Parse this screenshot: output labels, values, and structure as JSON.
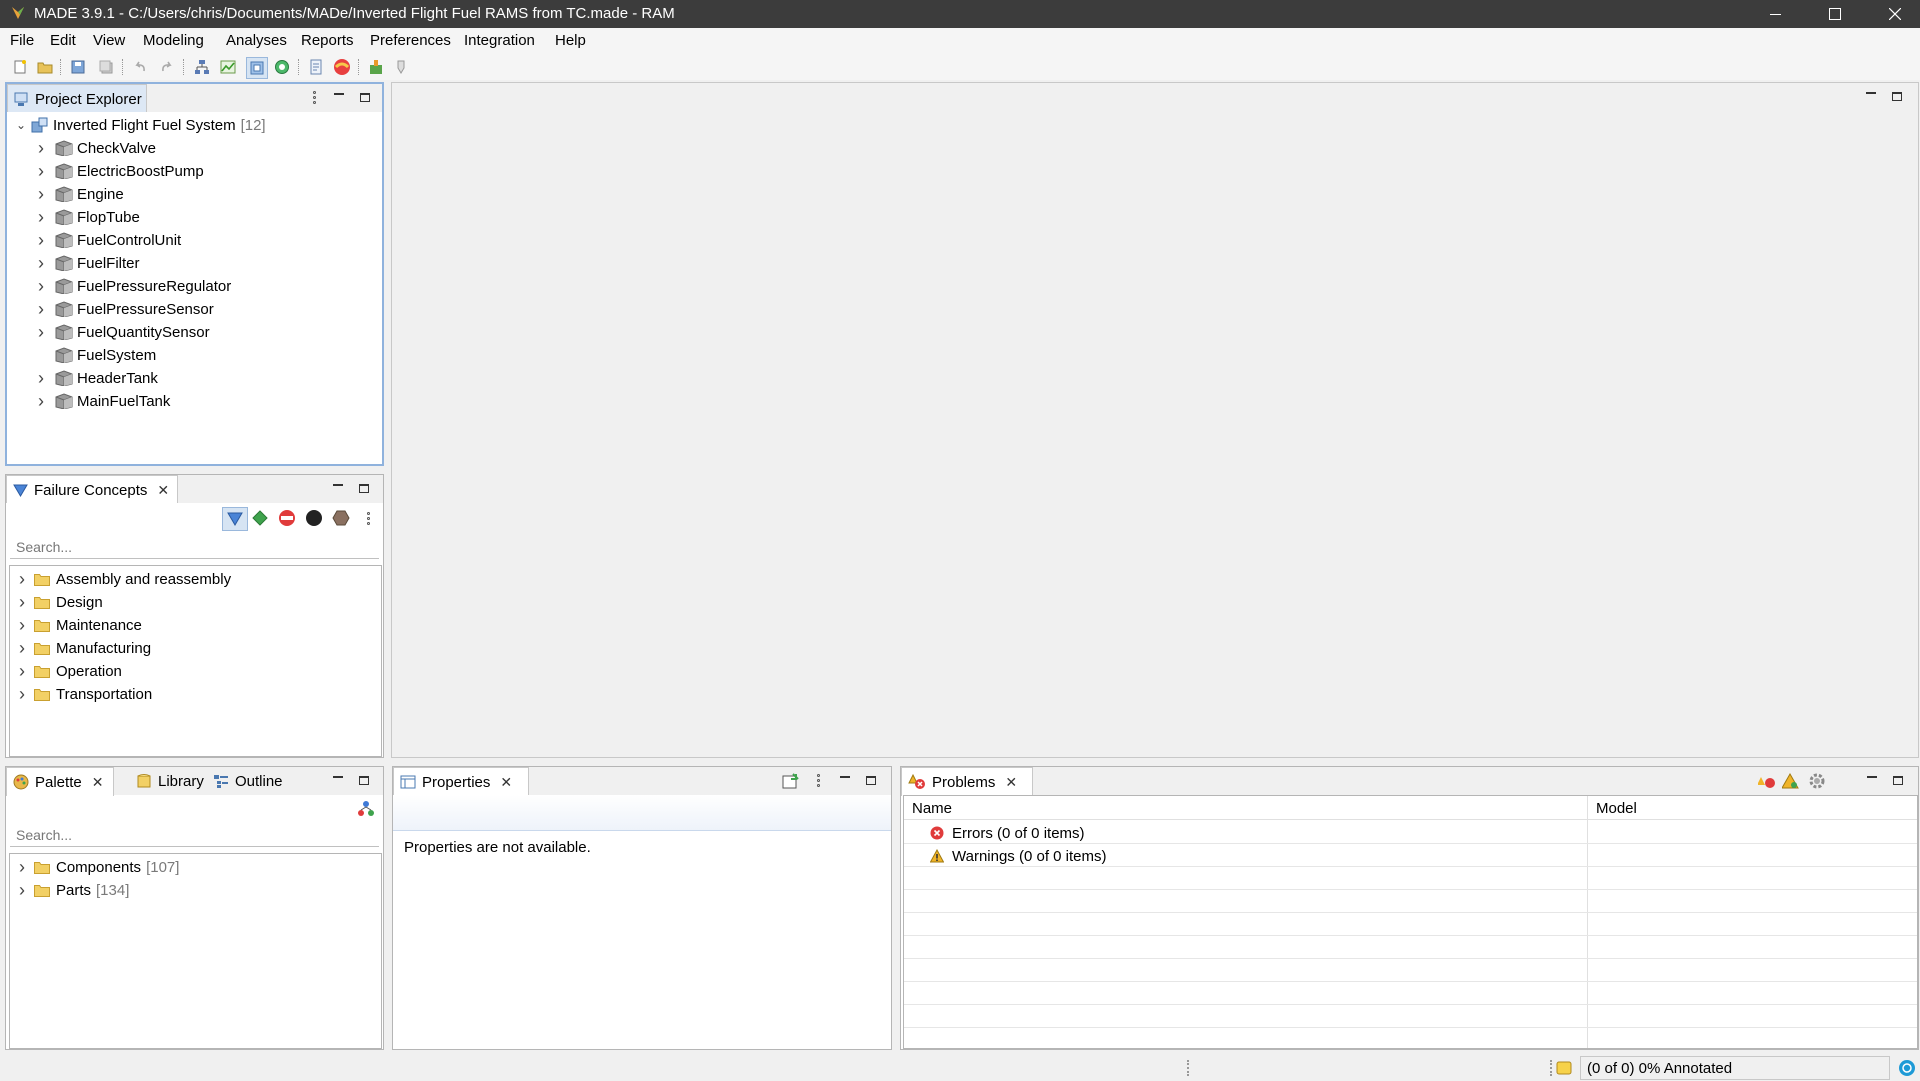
{
  "window": {
    "title": "MADE 3.9.1 - C:/Users/chris/Documents/MADe/Inverted Flight Fuel RAMS from TC.made - RAM"
  },
  "menu": [
    "File",
    "Edit",
    "View",
    "Modeling",
    "Analyses",
    "Reports",
    "Preferences",
    "Integration",
    "Help"
  ],
  "project_explorer": {
    "tab_label": "Project Explorer",
    "root": {
      "label": "Inverted Flight Fuel System",
      "count": "[12]"
    },
    "items": [
      {
        "label": "CheckValve",
        "expandable": true
      },
      {
        "label": "ElectricBoostPump",
        "expandable": true
      },
      {
        "label": "Engine",
        "expandable": true
      },
      {
        "label": "FlopTube",
        "expandable": true
      },
      {
        "label": "FuelControlUnit",
        "expandable": true
      },
      {
        "label": "FuelFilter",
        "expandable": true
      },
      {
        "label": "FuelPressureRegulator",
        "expandable": true
      },
      {
        "label": "FuelPressureSensor",
        "expandable": true
      },
      {
        "label": "FuelQuantitySensor",
        "expandable": true
      },
      {
        "label": "FuelSystem",
        "expandable": false
      },
      {
        "label": "HeaderTank",
        "expandable": true
      },
      {
        "label": "MainFuelTank",
        "expandable": true
      }
    ]
  },
  "failure_concepts": {
    "tab_label": "Failure Concepts",
    "search_placeholder": "Search...",
    "folders": [
      "Assembly and reassembly",
      "Design",
      "Maintenance",
      "Manufacturing",
      "Operation",
      "Transportation"
    ]
  },
  "palette": {
    "tabs": [
      "Palette",
      "Library",
      "Outline"
    ],
    "search_placeholder": "Search...",
    "folders": [
      {
        "label": "Components",
        "count": "[107]"
      },
      {
        "label": "Parts",
        "count": "[134]"
      }
    ]
  },
  "properties": {
    "tab_label": "Properties",
    "message": "Properties are not available."
  },
  "problems": {
    "tab_label": "Problems",
    "columns": [
      "Name",
      "Model"
    ],
    "rows": [
      {
        "label": "Errors (0 of 0 items)",
        "kind": "error"
      },
      {
        "label": "Warnings (0 of 0 items)",
        "kind": "warning"
      }
    ]
  },
  "status": {
    "annotated": "(0 of 0) 0% Annotated"
  },
  "colors": {
    "titlebar": "#3c3c3c",
    "focus_border": "#6e9fd8",
    "error": "#e03b3b",
    "warning": "#f0b429"
  }
}
